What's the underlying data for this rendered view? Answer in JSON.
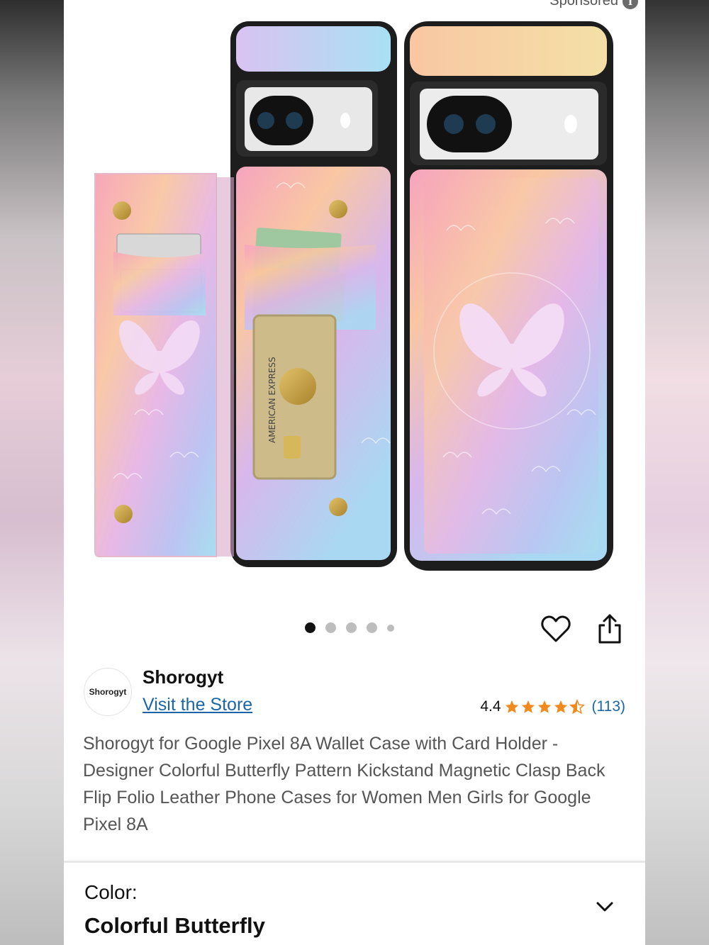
{
  "header": {
    "sponsored_label": "Sponsored"
  },
  "product": {
    "image_alt": "Pixel 8A wallet case in colorful butterfly pattern",
    "carousel": {
      "total_images": 5,
      "active_index": 0
    },
    "title": "Shorogyt for Google Pixel 8A Wallet Case with Card Holder - Designer Colorful Butterfly Pattern Kickstand Magnetic Clasp Back Flip Folio Leather Phone Cases for Women Men Girls for Google Pixel 8A"
  },
  "brand": {
    "logo_text": "Shorogyt",
    "name": "Shorogyt",
    "visit_store_label": "Visit the Store"
  },
  "rating": {
    "score": "4.4",
    "stars": 4.4,
    "count_label": "(113)"
  },
  "variant": {
    "label": "Color:",
    "value": "Colorful Butterfly"
  },
  "colors": {
    "link": "#1a66a8",
    "star": "#f08a1c"
  },
  "icons": {
    "wishlist": "heart-icon",
    "share": "share-icon",
    "info": "info-icon",
    "expand": "chevron-down-icon"
  }
}
